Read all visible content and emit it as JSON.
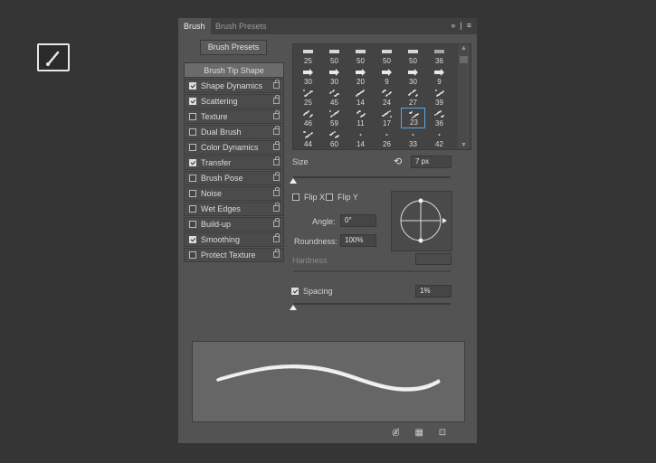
{
  "tabs": [
    "Brush",
    "Brush Presets"
  ],
  "header_icons": [
    "»",
    "≡"
  ],
  "buttons": {
    "brush_presets": "Brush Presets"
  },
  "options": [
    {
      "label": "Brush Tip Shape",
      "checked": null,
      "lock": false
    },
    {
      "label": "Shape Dynamics",
      "checked": true,
      "lock": true
    },
    {
      "label": "Scattering",
      "checked": true,
      "lock": true
    },
    {
      "label": "Texture",
      "checked": false,
      "lock": true
    },
    {
      "label": "Dual Brush",
      "checked": false,
      "lock": true
    },
    {
      "label": "Color Dynamics",
      "checked": false,
      "lock": true
    },
    {
      "label": "Transfer",
      "checked": true,
      "lock": true
    },
    {
      "label": "Brush Pose",
      "checked": false,
      "lock": true
    },
    {
      "label": "Noise",
      "checked": false,
      "lock": true
    },
    {
      "label": "Wet Edges",
      "checked": false,
      "lock": true
    },
    {
      "label": "Build-up",
      "checked": false,
      "lock": true
    },
    {
      "label": "Smoothing",
      "checked": true,
      "lock": true
    },
    {
      "label": "Protect Texture",
      "checked": false,
      "lock": true
    }
  ],
  "brush_grid": [
    [
      "25",
      "50",
      "50",
      "50",
      "50",
      "36"
    ],
    [
      "30",
      "30",
      "20",
      "9",
      "30",
      "9"
    ],
    [
      "25",
      "45",
      "14",
      "24",
      "27",
      "39"
    ],
    [
      "46",
      "59",
      "11",
      "17",
      "23",
      "36"
    ],
    [
      "44",
      "60",
      "14",
      "26",
      "33",
      "42"
    ]
  ],
  "selected_brush": "23",
  "size": {
    "label": "Size",
    "value": "7 px",
    "fraction": 0.0
  },
  "flip": {
    "x_label": "Flip X",
    "y_label": "Flip Y",
    "x": false,
    "y": false
  },
  "angle": {
    "label": "Angle:",
    "value": "0°"
  },
  "roundness": {
    "label": "Roundness:",
    "value": "100%"
  },
  "hardness": {
    "label": "Hardness",
    "value": ""
  },
  "spacing": {
    "label": "Spacing",
    "value": "1%",
    "checked": true,
    "fraction": 0.0
  },
  "footer_icons": [
    "eye-slash-icon",
    "grid-icon",
    "new-page-icon"
  ],
  "colors": {
    "panel_bg": "#535353",
    "page_bg": "#353535",
    "selection": "#5ba6e0"
  }
}
